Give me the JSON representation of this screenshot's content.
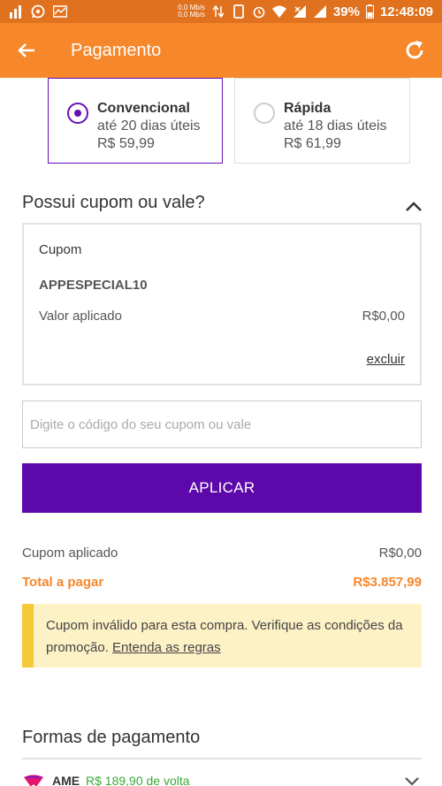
{
  "status_bar": {
    "net_up": "0,0 Mb/s",
    "net_down": "0,0 Mb/s",
    "battery": "39%",
    "time": "12:48:09"
  },
  "app_bar": {
    "title": "Pagamento",
    "back_icon": "arrow-left-icon",
    "refresh_icon": "refresh-icon",
    "color": "#f6872a"
  },
  "shipping": [
    {
      "name": "Convencional",
      "eta": "até 20 dias úteis",
      "price": "R$ 59,99",
      "selected": true
    },
    {
      "name": "Rápida",
      "eta": "até 18 dias úteis",
      "price": "R$ 61,99",
      "selected": false
    }
  ],
  "coupon_section": {
    "title": "Possui cupom ou vale?",
    "box_label": "Cupom",
    "code": "APPESPECIAL10",
    "applied_label": "Valor aplicado",
    "applied_value": "R$0,00",
    "remove_label": "excluir",
    "input_placeholder": "Digite o código do seu cupom ou vale",
    "input_value": "",
    "apply_button": "APLICAR",
    "button_color": "#5d08aa"
  },
  "summary": {
    "coupon_label": "Cupom aplicado",
    "coupon_value": "R$0,00",
    "total_label": "Total a pagar",
    "total_value": "R$3.857,99"
  },
  "warning": {
    "text": "Cupom inválido para esta compra. Verifique as condições da promoção. ",
    "link": "Entenda as regras"
  },
  "payment": {
    "title": "Formas de pagamento",
    "first_method": {
      "name": "AME",
      "cashback": "R$ 189,90 de volta"
    }
  }
}
